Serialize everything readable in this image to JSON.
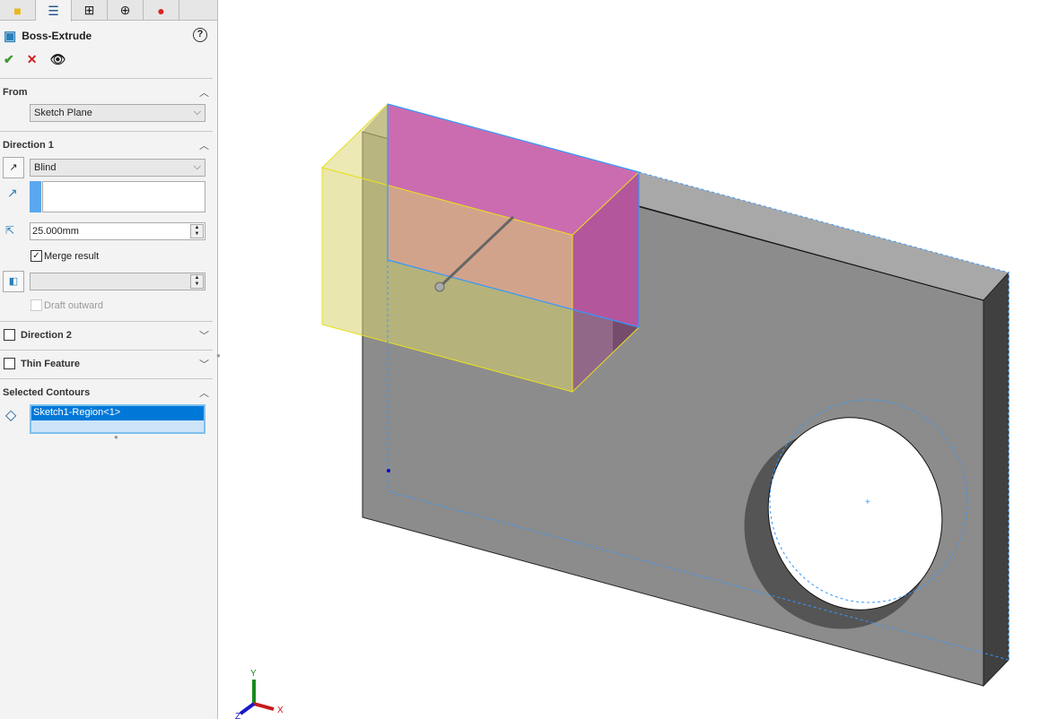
{
  "tabs": [
    {
      "name": "feature-manager",
      "icon": "part-icon"
    },
    {
      "name": "property-manager",
      "icon": "property-list-icon"
    },
    {
      "name": "configuration-manager",
      "icon": "configuration-icon"
    },
    {
      "name": "dimxpert-manager",
      "icon": "crosshair-icon"
    },
    {
      "name": "display-manager",
      "icon": "appearance-ball-icon"
    }
  ],
  "feature": {
    "title": "Boss-Extrude",
    "help": "?"
  },
  "from": {
    "header": "From",
    "value": "Sketch Plane"
  },
  "direction1": {
    "header": "Direction 1",
    "end_condition": "Blind",
    "depth": "25.000mm",
    "merge_label": "Merge result",
    "merge_checked": true,
    "draft_label": "Draft outward",
    "draft_value": ""
  },
  "direction2": {
    "header": "Direction 2",
    "checked": false
  },
  "thin": {
    "header": "Thin Feature",
    "checked": false
  },
  "contours": {
    "header": "Selected Contours",
    "items": [
      "Sketch1-Region<1>"
    ]
  },
  "triad": {
    "x": "X",
    "y": "Y",
    "z": "Z"
  },
  "colors": {
    "accent": "#0078d7",
    "preview_face": "#cc6cb0",
    "preview_body": "#e0e090",
    "part": "#8c8c8c"
  }
}
